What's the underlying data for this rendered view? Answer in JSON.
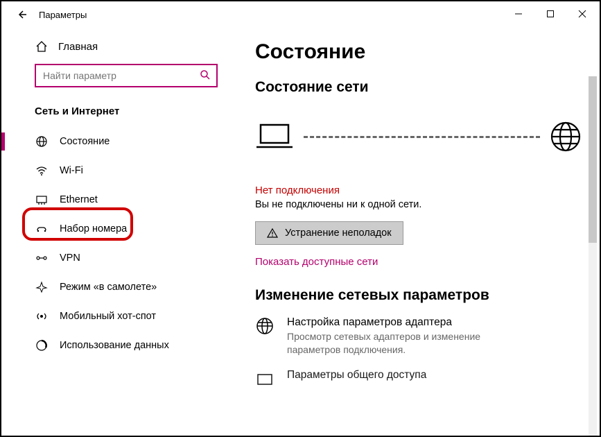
{
  "window": {
    "title": "Параметры"
  },
  "sidebar": {
    "home_label": "Главная",
    "search_placeholder": "Найти параметр",
    "section_title": "Сеть и Интернет",
    "items": [
      {
        "label": "Состояние"
      },
      {
        "label": "Wi-Fi"
      },
      {
        "label": "Ethernet"
      },
      {
        "label": "Набор номера"
      },
      {
        "label": "VPN"
      },
      {
        "label": "Режим «в самолете»"
      },
      {
        "label": "Мобильный хот-спот"
      },
      {
        "label": "Использование данных"
      }
    ]
  },
  "main": {
    "page_title": "Состояние",
    "section1_title": "Состояние сети",
    "error_title": "Нет подключения",
    "error_desc": "Вы не подключены ни к одной сети.",
    "troubleshoot_btn": "Устранение неполадок",
    "show_networks_link": "Показать доступные сети",
    "section2_title": "Изменение сетевых параметров",
    "adapter_title": "Настройка параметров адаптера",
    "adapter_desc": "Просмотр сетевых адаптеров и изменение параметров подключения.",
    "sharing_title_partial": "Параметры общего доступа"
  }
}
